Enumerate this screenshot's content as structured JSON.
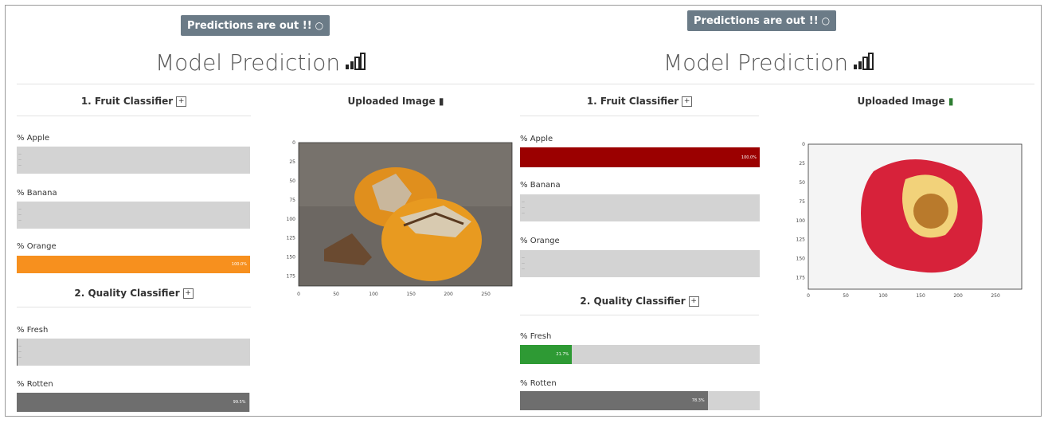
{
  "panels": [
    {
      "badge": "Predictions are out !!",
      "title": "Model Prediction",
      "fruit_header": "1. Fruit Classifier",
      "quality_header": "2. Quality Classifier",
      "uploaded_header": "Uploaded Image",
      "pct_symbol": "%",
      "fruit": [
        {
          "label": "Apple",
          "percent": 0.0,
          "color": "#d3d3d3"
        },
        {
          "label": "Banana",
          "percent": 0.0,
          "color": "#d3d3d3"
        },
        {
          "label": "Orange",
          "percent": 100.0,
          "color": "#f7901e"
        }
      ],
      "quality": [
        {
          "label": "Fresh",
          "percent": 0.5,
          "color": "#555555"
        },
        {
          "label": "Rotten",
          "percent": 99.5,
          "color": "#6e6e6e"
        }
      ],
      "image_subject": "rotten orange",
      "x_ticks": [
        "0",
        "50",
        "100",
        "150",
        "200",
        "250"
      ],
      "y_ticks": [
        "0",
        "25",
        "50",
        "75",
        "100",
        "125",
        "150",
        "175"
      ]
    },
    {
      "badge": "Predictions are out !!",
      "title": "Model Prediction",
      "fruit_header": "1. Fruit Classifier",
      "quality_header": "2. Quality Classifier",
      "uploaded_header": "Uploaded Image",
      "pct_symbol": "%",
      "fruit": [
        {
          "label": "Apple",
          "percent": 100.0,
          "color": "#9b0000"
        },
        {
          "label": "Banana",
          "percent": 0.0,
          "color": "#d3d3d3"
        },
        {
          "label": "Orange",
          "percent": 0.0,
          "color": "#d3d3d3"
        }
      ],
      "quality": [
        {
          "label": "Fresh",
          "percent": 21.7,
          "color": "#2e9a34"
        },
        {
          "label": "Rotten",
          "percent": 78.3,
          "color": "#6e6e6e"
        }
      ],
      "image_subject": "bitten red apple",
      "x_ticks": [
        "0",
        "50",
        "100",
        "150",
        "200",
        "250"
      ],
      "y_ticks": [
        "0",
        "25",
        "50",
        "75",
        "100",
        "125",
        "150",
        "175"
      ]
    }
  ]
}
